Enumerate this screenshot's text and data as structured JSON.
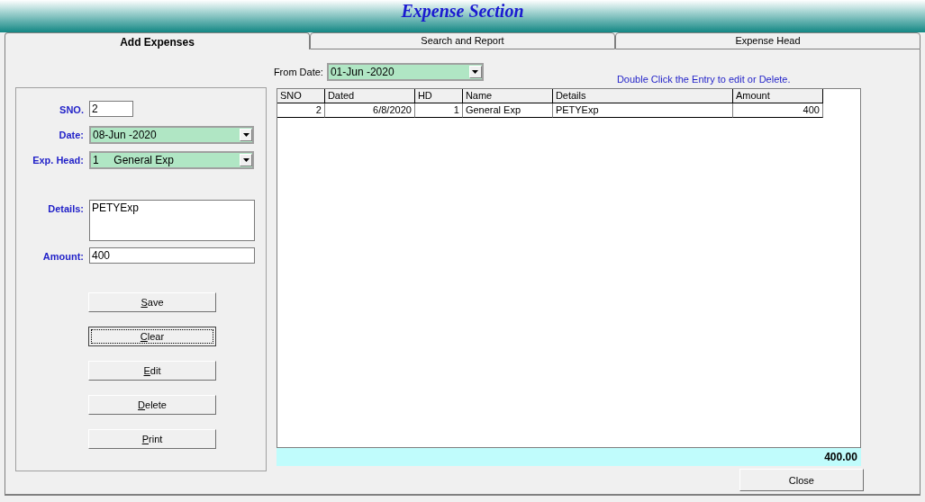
{
  "window": {
    "title": "Expense Section"
  },
  "tabs": [
    {
      "label": "Add Expenses",
      "selected": true
    },
    {
      "label": "Search and Report",
      "selected": false
    },
    {
      "label": "Expense Head",
      "selected": false
    }
  ],
  "form": {
    "fields": [
      {
        "kind": "text",
        "label": "SNO.",
        "value": "2"
      },
      {
        "kind": "combo",
        "label": "Date:",
        "value": "08-Jun -2020"
      },
      {
        "kind": "combo",
        "label": "Exp. Head:",
        "value": "1     General Exp"
      },
      {
        "kind": "memo",
        "label": "Details:",
        "value": "PETYExp"
      },
      {
        "kind": "text",
        "label": "Amount:",
        "value": "400"
      }
    ],
    "buttons": [
      {
        "label": "Save",
        "focused": false
      },
      {
        "label": "Clear",
        "focused": true
      },
      {
        "label": "Edit",
        "focused": false
      },
      {
        "label": "Delete",
        "focused": false
      },
      {
        "label": "Print",
        "focused": false
      }
    ]
  },
  "filter": {
    "label": "From Date:",
    "value": "01-Jun -2020"
  },
  "hint": "Double Click the Entry to edit or Delete.",
  "table": {
    "columns": [
      {
        "label": "SNO"
      },
      {
        "label": "Dated"
      },
      {
        "label": "HD"
      },
      {
        "label": "Name"
      },
      {
        "label": "Details"
      },
      {
        "label": "Amount"
      }
    ],
    "rows": [
      [
        "2",
        "6/8/2020",
        "1",
        "General Exp",
        "PETYExp",
        "400"
      ]
    ]
  },
  "total": "400.00",
  "close_button": {
    "label": "Close"
  }
}
